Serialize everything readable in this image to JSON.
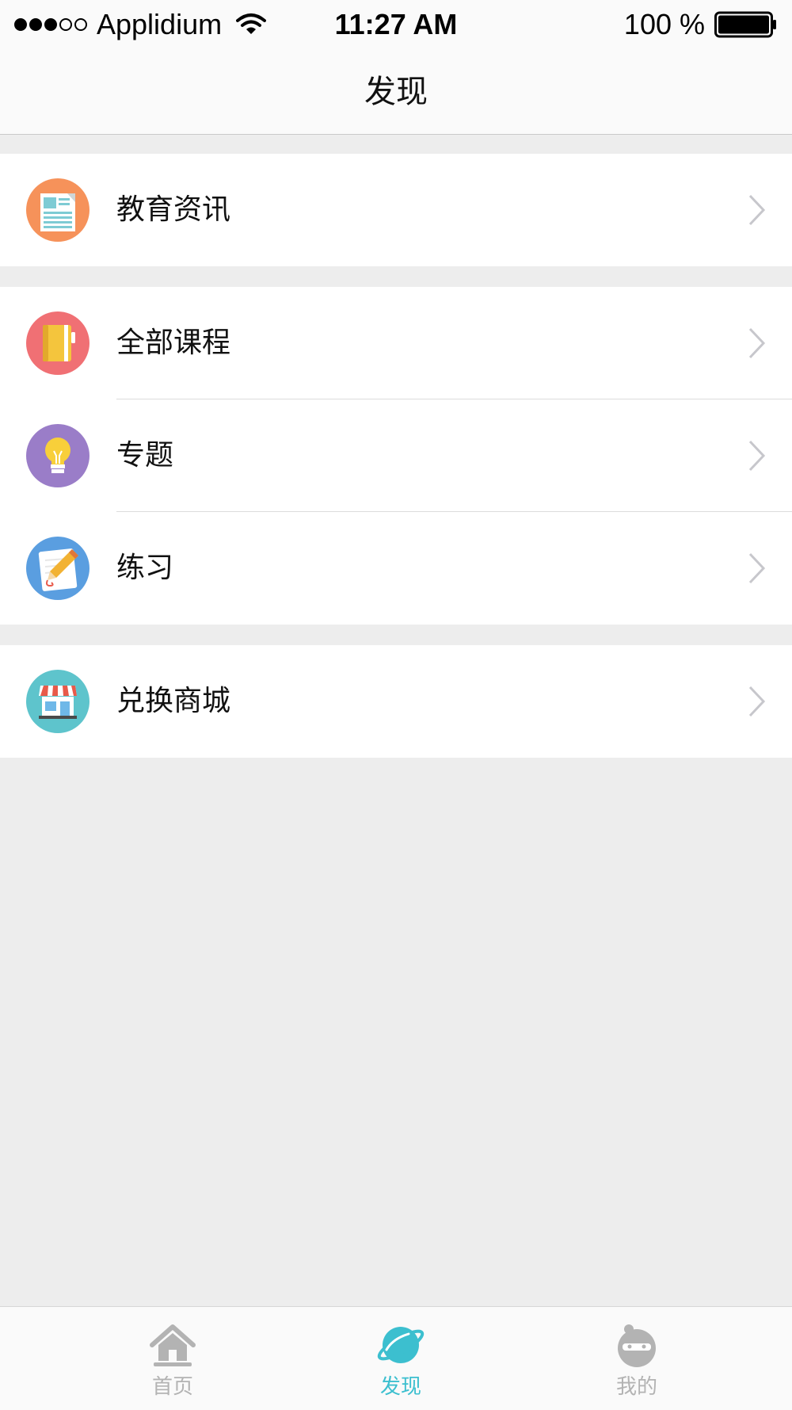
{
  "status_bar": {
    "carrier": "Applidium",
    "time": "11:27 AM",
    "battery": "100 %"
  },
  "nav": {
    "title": "发现"
  },
  "groups": [
    {
      "items": [
        {
          "label": "教育资讯",
          "icon": "news-icon",
          "color": "#f6925a"
        }
      ]
    },
    {
      "items": [
        {
          "label": "全部课程",
          "icon": "notebook-icon",
          "color": "#f07074"
        },
        {
          "label": "专题",
          "icon": "lightbulb-icon",
          "color": "#9a7dc8"
        },
        {
          "label": "练习",
          "icon": "practice-pencil-icon",
          "color": "#5a9ee0"
        }
      ]
    },
    {
      "items": [
        {
          "label": "兑换商城",
          "icon": "store-icon",
          "color": "#5ec4cc"
        }
      ]
    }
  ],
  "tabs": [
    {
      "label": "首页",
      "icon": "home-icon",
      "active": false
    },
    {
      "label": "发现",
      "icon": "planet-icon",
      "active": true
    },
    {
      "label": "我的",
      "icon": "profile-face-icon",
      "active": false
    }
  ],
  "colors": {
    "accent": "#3cbfcf",
    "tab_inactive": "#b3b3b3",
    "background": "#ededed"
  }
}
